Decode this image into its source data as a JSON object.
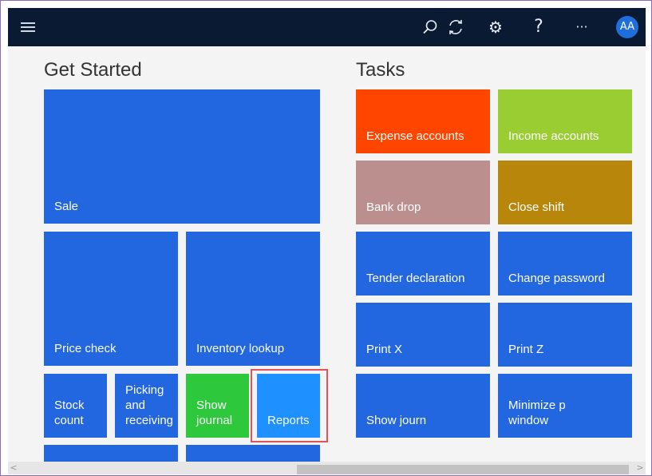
{
  "topbar": {
    "menu_icon": "hamburger-icon",
    "icons": [
      "search-icon",
      "sync-icon",
      "gear-icon",
      "help-icon",
      "more-icon"
    ],
    "search_glyph": "⚲",
    "sync_glyph": "⟳",
    "gear_glyph": "⚙",
    "help_glyph": "?",
    "more_glyph": "···",
    "avatar_initials": "AA"
  },
  "get_started": {
    "title": "Get Started",
    "tiles": {
      "sale": "Sale",
      "price_check": "Price check",
      "inventory_lookup": "Inventory lookup",
      "stock_count": "Stock\ncount",
      "picking_receiving": "Picking\nand\nreceiving",
      "show_journal": "Show\njournal",
      "reports": "Reports"
    }
  },
  "tasks": {
    "title": "Tasks",
    "tiles": {
      "expense_accounts": "Expense accounts",
      "income_accounts": "Income accounts",
      "bank_drop": "Bank drop",
      "close_shift": "Close shift",
      "tender_declaration": "Tender declaration",
      "change_password": "Change password",
      "print_x": "Print X",
      "print_z": "Print Z",
      "show_journal": "Show journ",
      "minimize_window": "Minimize p\nwindow"
    }
  },
  "colors": {
    "topbar": "#0b1a33",
    "tile_blue": "#2266e0",
    "tile_lightblue": "#1e90ff",
    "tile_green": "#2ec83c",
    "expense_orange": "#ff4500",
    "income_green": "#9acd32",
    "bank_drop_mauve": "#bc8f8f",
    "close_shift_gold": "#b8860b",
    "highlight_red": "#e0535a"
  }
}
